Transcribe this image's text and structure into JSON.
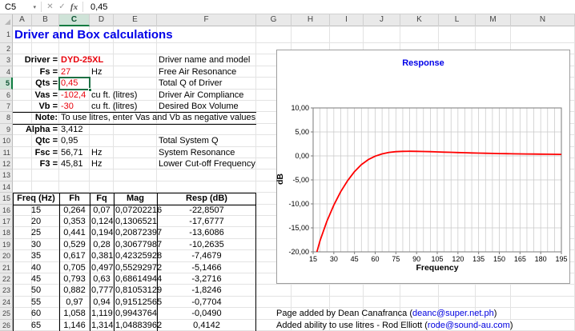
{
  "formula_bar": {
    "cell_ref": "C5",
    "value": "0,45",
    "fx_label": "fx",
    "cancel_glyph": "✕",
    "enter_glyph": "✓",
    "chevron_glyph": "▾"
  },
  "sheet": {
    "columns": [
      "A",
      "B",
      "C",
      "D",
      "E",
      "F",
      "G",
      "H",
      "I",
      "J",
      "K",
      "L",
      "M",
      "N"
    ],
    "rows": [
      1,
      2,
      3,
      4,
      5,
      6,
      7,
      8,
      9,
      10,
      11,
      12,
      13,
      14,
      15,
      16,
      17,
      18,
      19,
      20,
      21,
      22,
      23,
      24,
      25,
      26
    ],
    "selected": {
      "col": "C",
      "row": 5
    },
    "cells": [
      {
        "r": 1,
        "c": "A",
        "t": "Driver and Box calculations",
        "s": "title"
      },
      {
        "r": 3,
        "c": "A",
        "span": "B",
        "t": "Driver =",
        "s": "lbl"
      },
      {
        "r": 3,
        "c": "C",
        "t": "DYD-25XL",
        "s": "redb"
      },
      {
        "r": 3,
        "c": "F",
        "t": "Driver name and model",
        "s": "plain"
      },
      {
        "r": 4,
        "c": "A",
        "span": "B",
        "t": "Fs =",
        "s": "lbl"
      },
      {
        "r": 4,
        "c": "C",
        "t": "27",
        "s": "red"
      },
      {
        "r": 4,
        "c": "D",
        "t": "Hz",
        "s": "plain"
      },
      {
        "r": 4,
        "c": "F",
        "t": "Free Air Resonance",
        "s": "plain"
      },
      {
        "r": 5,
        "c": "A",
        "span": "B",
        "t": "Qts =",
        "s": "lbl"
      },
      {
        "r": 5,
        "c": "C",
        "t": "0,45",
        "s": "red"
      },
      {
        "r": 5,
        "c": "F",
        "t": "Total Q of Driver",
        "s": "plain"
      },
      {
        "r": 6,
        "c": "A",
        "span": "B",
        "t": "Vas =",
        "s": "lbl"
      },
      {
        "r": 6,
        "c": "C",
        "t": "-102,4",
        "s": "red"
      },
      {
        "r": 6,
        "c": "D",
        "t": "cu ft. (litres)",
        "s": "plain"
      },
      {
        "r": 6,
        "c": "F",
        "t": "Driver Air Compliance",
        "s": "plain"
      },
      {
        "r": 7,
        "c": "A",
        "span": "B",
        "t": "Vb =",
        "s": "lbl"
      },
      {
        "r": 7,
        "c": "C",
        "t": "-30",
        "s": "red"
      },
      {
        "r": 7,
        "c": "D",
        "t": "cu ft. (litres)",
        "s": "plain"
      },
      {
        "r": 7,
        "c": "F",
        "t": "Desired Box Volume",
        "s": "plain"
      },
      {
        "r": 8,
        "c": "A",
        "span": "B",
        "t": "Note:",
        "s": "lbl"
      },
      {
        "r": 8,
        "c": "C",
        "t": "To use litres, enter Vas and Vb as negative values",
        "s": "plain"
      },
      {
        "r": 9,
        "c": "A",
        "span": "B",
        "t": "Alpha =",
        "s": "lbl"
      },
      {
        "r": 9,
        "c": "C",
        "t": "3,412",
        "s": "plain"
      },
      {
        "r": 10,
        "c": "A",
        "span": "B",
        "t": "Qtc =",
        "s": "lbl"
      },
      {
        "r": 10,
        "c": "C",
        "t": "0,95",
        "s": "plain"
      },
      {
        "r": 10,
        "c": "F",
        "t": "Total System Q",
        "s": "plain"
      },
      {
        "r": 11,
        "c": "A",
        "span": "B",
        "t": "Fsc =",
        "s": "lbl"
      },
      {
        "r": 11,
        "c": "C",
        "t": "56,71",
        "s": "plain"
      },
      {
        "r": 11,
        "c": "D",
        "t": "Hz",
        "s": "plain"
      },
      {
        "r": 11,
        "c": "F",
        "t": "System Resonance",
        "s": "plain"
      },
      {
        "r": 12,
        "c": "A",
        "span": "B",
        "t": "F3 =",
        "s": "lbl"
      },
      {
        "r": 12,
        "c": "C",
        "t": "45,81",
        "s": "plain"
      },
      {
        "r": 12,
        "c": "D",
        "t": "Hz",
        "s": "plain"
      },
      {
        "r": 12,
        "c": "F",
        "t": "Lower Cut-off Frequency",
        "s": "plain"
      }
    ]
  },
  "table": {
    "start_row": 15,
    "headers": [
      "Freq (Hz)",
      "Fh",
      "Fq",
      "Mag",
      "Resp (dB)"
    ],
    "rows": [
      [
        "15",
        "0,264",
        "0,07",
        "0,07202216",
        "-22,8507"
      ],
      [
        "20",
        "0,353",
        "0,124",
        "0,1306521",
        "-17,6777"
      ],
      [
        "25",
        "0,441",
        "0,194",
        "0,20872397",
        "-13,6086"
      ],
      [
        "30",
        "0,529",
        "0,28",
        "0,30677987",
        "-10,2635"
      ],
      [
        "35",
        "0,617",
        "0,381",
        "0,42325928",
        "-7,4679"
      ],
      [
        "40",
        "0,705",
        "0,497",
        "0,55292972",
        "-5,1466"
      ],
      [
        "45",
        "0,793",
        "0,63",
        "0,68614944",
        "-3,2716"
      ],
      [
        "50",
        "0,882",
        "0,777",
        "0,81053129",
        "-1,8246"
      ],
      [
        "55",
        "0,97",
        "0,94",
        "0,91512565",
        "-0,7704"
      ],
      [
        "60",
        "1,058",
        "1,119",
        "0,9943764",
        "-0,0490"
      ],
      [
        "65",
        "1,146",
        "1,314",
        "1,04883962",
        "0,4142"
      ]
    ]
  },
  "chart_data": {
    "type": "line",
    "title": "Response",
    "xlabel": "Frequency",
    "ylabel": "dB",
    "xlim": [
      15,
      195
    ],
    "ylim": [
      -20,
      10
    ],
    "grid": true,
    "legend": false,
    "x_ticks": [
      15,
      30,
      45,
      60,
      75,
      90,
      105,
      120,
      135,
      150,
      165,
      180,
      195
    ],
    "y_tick_labels": [
      "10,00",
      "5,00",
      "0,00",
      "-5,00",
      "-10,00",
      "-15,00",
      "-20,00"
    ],
    "series": [
      {
        "name": "Response",
        "color": "#ff0000",
        "x": [
          15,
          20,
          25,
          30,
          35,
          40,
          45,
          50,
          55,
          60,
          65,
          70,
          75,
          80,
          85,
          90,
          95,
          100,
          105,
          110,
          115,
          120,
          125,
          130,
          135,
          140,
          145,
          150,
          155,
          160,
          165,
          170,
          175,
          180,
          185,
          190,
          195
        ],
        "y": [
          -22.8507,
          -17.6777,
          -13.6086,
          -10.2635,
          -7.4679,
          -5.1466,
          -3.2716,
          -1.8246,
          -0.7704,
          -0.049,
          0.4142,
          0.73,
          0.88,
          0.95,
          0.96,
          0.95,
          0.92,
          0.88,
          0.84,
          0.79,
          0.75,
          0.7,
          0.66,
          0.62,
          0.58,
          0.55,
          0.52,
          0.49,
          0.46,
          0.44,
          0.42,
          0.4,
          0.38,
          0.36,
          0.35,
          0.33,
          0.31
        ]
      }
    ]
  },
  "footer": {
    "lines": [
      {
        "row": 25,
        "prefix": "Page added by Dean Canafranca (",
        "link": "deanc@super.net.ph",
        "suffix": ")"
      },
      {
        "row": 26,
        "prefix": "Added ability to use litres - Rod Elliott (",
        "link": "rode@sound-au.com",
        "suffix": ")"
      }
    ]
  }
}
